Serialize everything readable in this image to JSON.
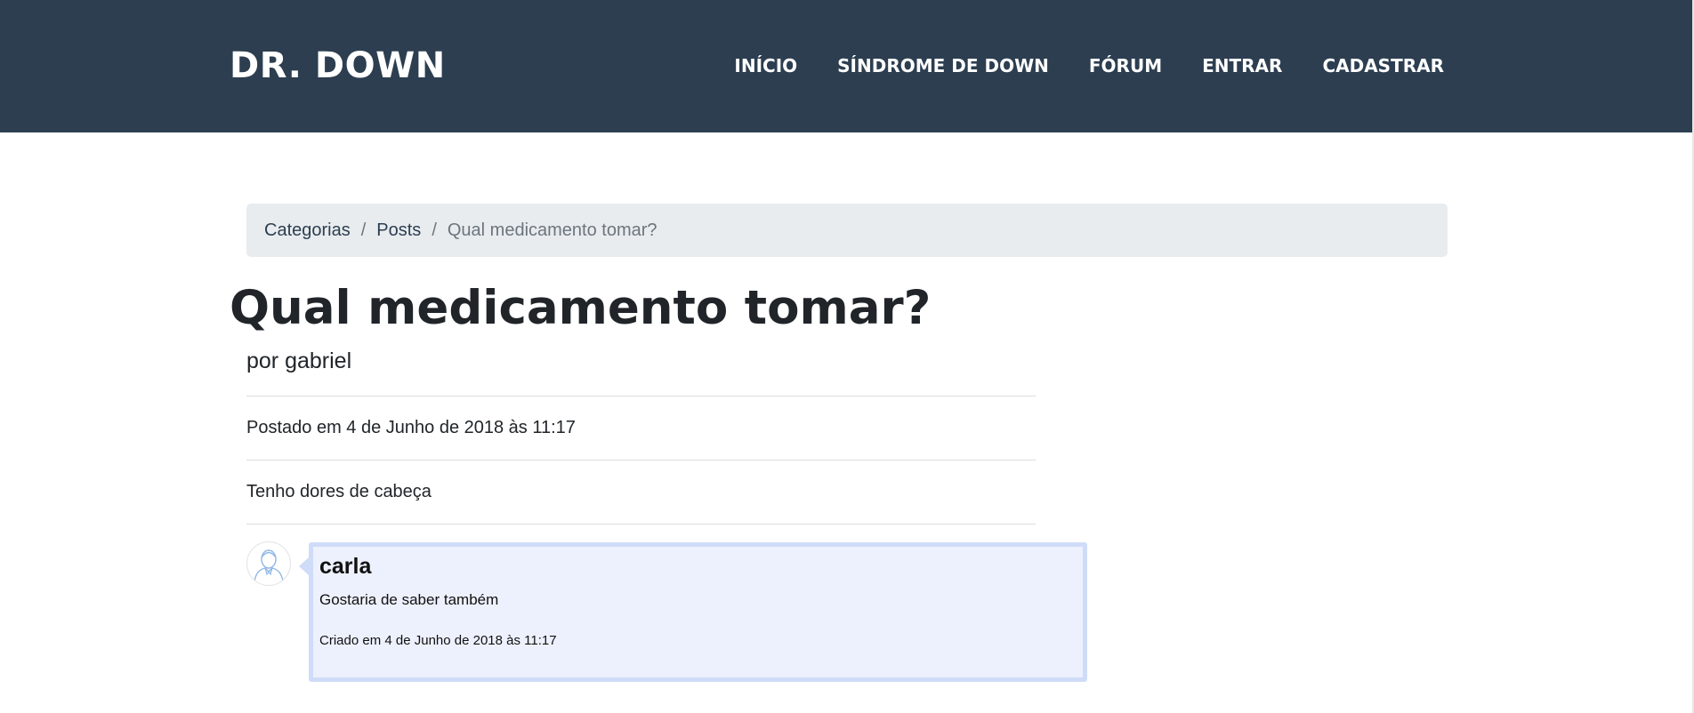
{
  "navbar": {
    "brand": "DR. DOWN",
    "items": [
      {
        "label": "INÍCIO"
      },
      {
        "label": "SÍNDROME DE DOWN"
      },
      {
        "label": "FÓRUM"
      },
      {
        "label": "ENTRAR"
      },
      {
        "label": "CADASTRAR"
      }
    ],
    "background_color": "#2c3e50"
  },
  "breadcrumb": {
    "items": [
      {
        "label": "Categorias"
      },
      {
        "label": "Posts"
      }
    ],
    "separator": "/",
    "current": "Qual medicamento tomar?"
  },
  "post": {
    "title": "Qual medicamento tomar?",
    "author": "por gabriel",
    "date": "Postado em 4 de Junho de 2018 às 11:17",
    "body": "Tenho dores de cabeça"
  },
  "comments": [
    {
      "author": "carla",
      "text": "Gostaria de saber também",
      "date": "Criado em 4 de Junho de 2018 às 11:17",
      "avatar_icon": "user-avatar-icon"
    }
  ],
  "colors": {
    "comment_bg": "#edf1fd",
    "comment_border": "#cfdcf8",
    "breadcrumb_bg": "#e9ecef"
  }
}
